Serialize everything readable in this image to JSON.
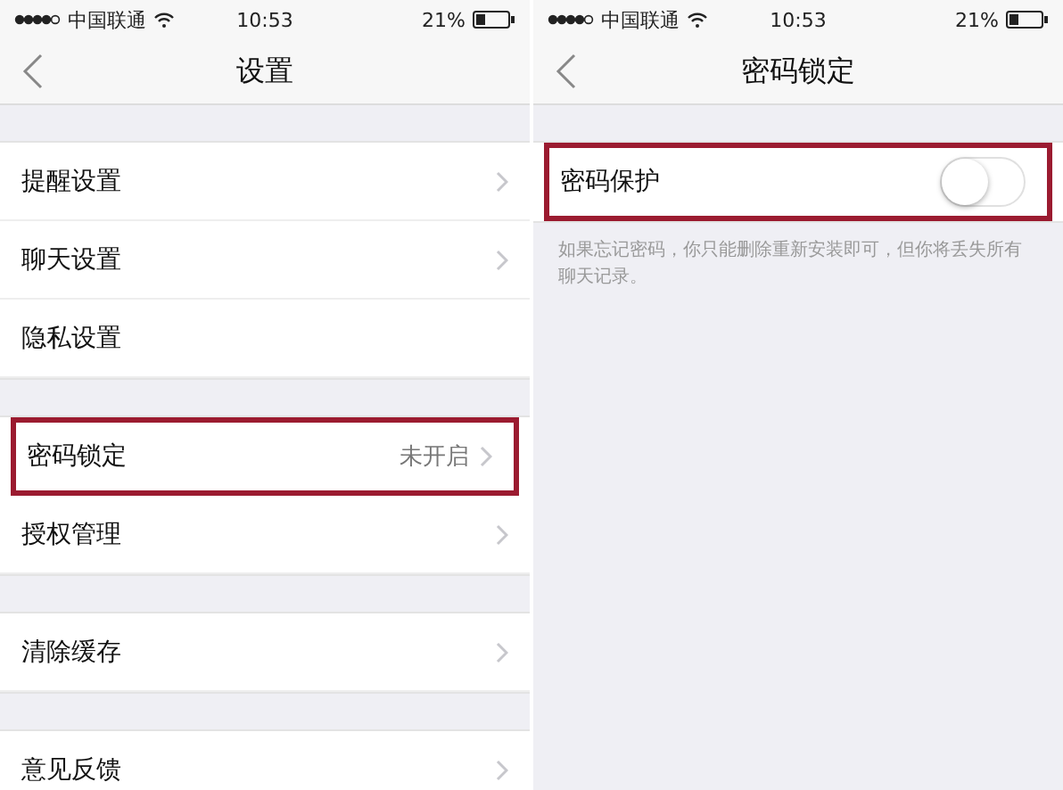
{
  "screens": [
    {
      "status_bar": {
        "carrier": "中国联通",
        "time": "10:53",
        "battery": "21%"
      },
      "title": "设置",
      "groups": [
        {
          "rows": [
            {
              "label": "提醒设置",
              "chevron": true,
              "highlighted": false
            },
            {
              "label": "聊天设置",
              "chevron": true,
              "highlighted": false
            },
            {
              "label": "隐私设置",
              "chevron": false,
              "highlighted": false
            }
          ]
        },
        {
          "rows": [
            {
              "label": "密码锁定",
              "value": "未开启",
              "chevron": true,
              "highlighted": true
            },
            {
              "label": "授权管理",
              "chevron": true,
              "highlighted": false
            }
          ]
        },
        {
          "rows": [
            {
              "label": "清除缓存",
              "chevron": true,
              "highlighted": false
            }
          ]
        },
        {
          "rows": [
            {
              "label": "意见反馈",
              "chevron": true,
              "highlighted": false
            }
          ]
        }
      ]
    },
    {
      "status_bar": {
        "carrier": "中国联通",
        "time": "10:53",
        "battery": "21%"
      },
      "title": "密码锁定",
      "groups": [
        {
          "rows": [
            {
              "label": "密码保护",
              "toggle": {
                "on": false
              },
              "highlighted": true
            }
          ],
          "note": "如果忘记密码，你只能删除重新安装即可，但你将丢失所有聊天记录。"
        }
      ]
    }
  ]
}
